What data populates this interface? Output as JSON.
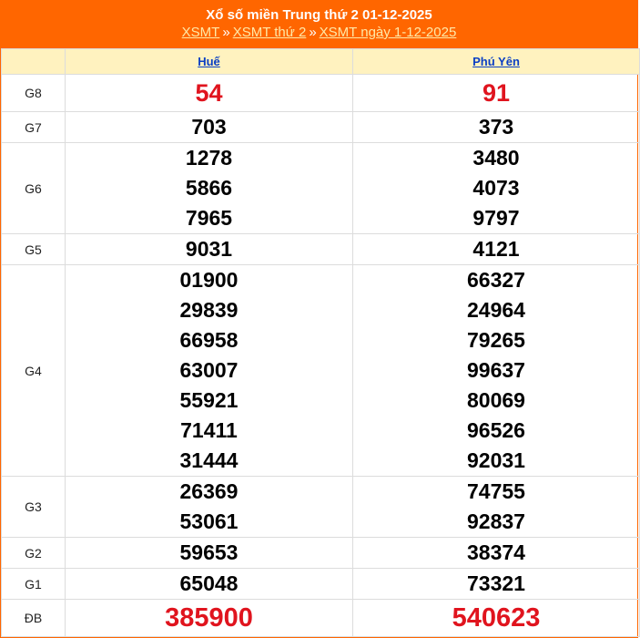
{
  "header": {
    "title": "Xổ số miền Trung thứ 2 01-12-2025",
    "crumbs": [
      "XSMT",
      "XSMT thứ 2",
      "XSMT ngày 1-12-2025"
    ],
    "separator": "»"
  },
  "columns": [
    "Huế",
    "Phú Yên"
  ],
  "prizes": [
    {
      "label": "G8",
      "hue": [
        "54"
      ],
      "phuyen": [
        "91"
      ]
    },
    {
      "label": "G7",
      "hue": [
        "703"
      ],
      "phuyen": [
        "373"
      ]
    },
    {
      "label": "G6",
      "hue": [
        "1278",
        "5866",
        "7965"
      ],
      "phuyen": [
        "3480",
        "4073",
        "9797"
      ]
    },
    {
      "label": "G5",
      "hue": [
        "9031"
      ],
      "phuyen": [
        "4121"
      ]
    },
    {
      "label": "G4",
      "hue": [
        "01900",
        "29839",
        "66958",
        "63007",
        "55921",
        "71411",
        "31444"
      ],
      "phuyen": [
        "66327",
        "24964",
        "79265",
        "99637",
        "80069",
        "96526",
        "92031"
      ]
    },
    {
      "label": "G3",
      "hue": [
        "26369",
        "53061"
      ],
      "phuyen": [
        "74755",
        "92837"
      ]
    },
    {
      "label": "G2",
      "hue": [
        "59653"
      ],
      "phuyen": [
        "38374"
      ]
    },
    {
      "label": "G1",
      "hue": [
        "65048"
      ],
      "phuyen": [
        "73321"
      ]
    },
    {
      "label": "ĐB",
      "hue": [
        "385900"
      ],
      "phuyen": [
        "540623"
      ]
    }
  ],
  "colors": {
    "accent": "#ff6600",
    "header_row": "#fff2bf",
    "highlight": "#e0141e",
    "link": "#0a3fc4"
  }
}
